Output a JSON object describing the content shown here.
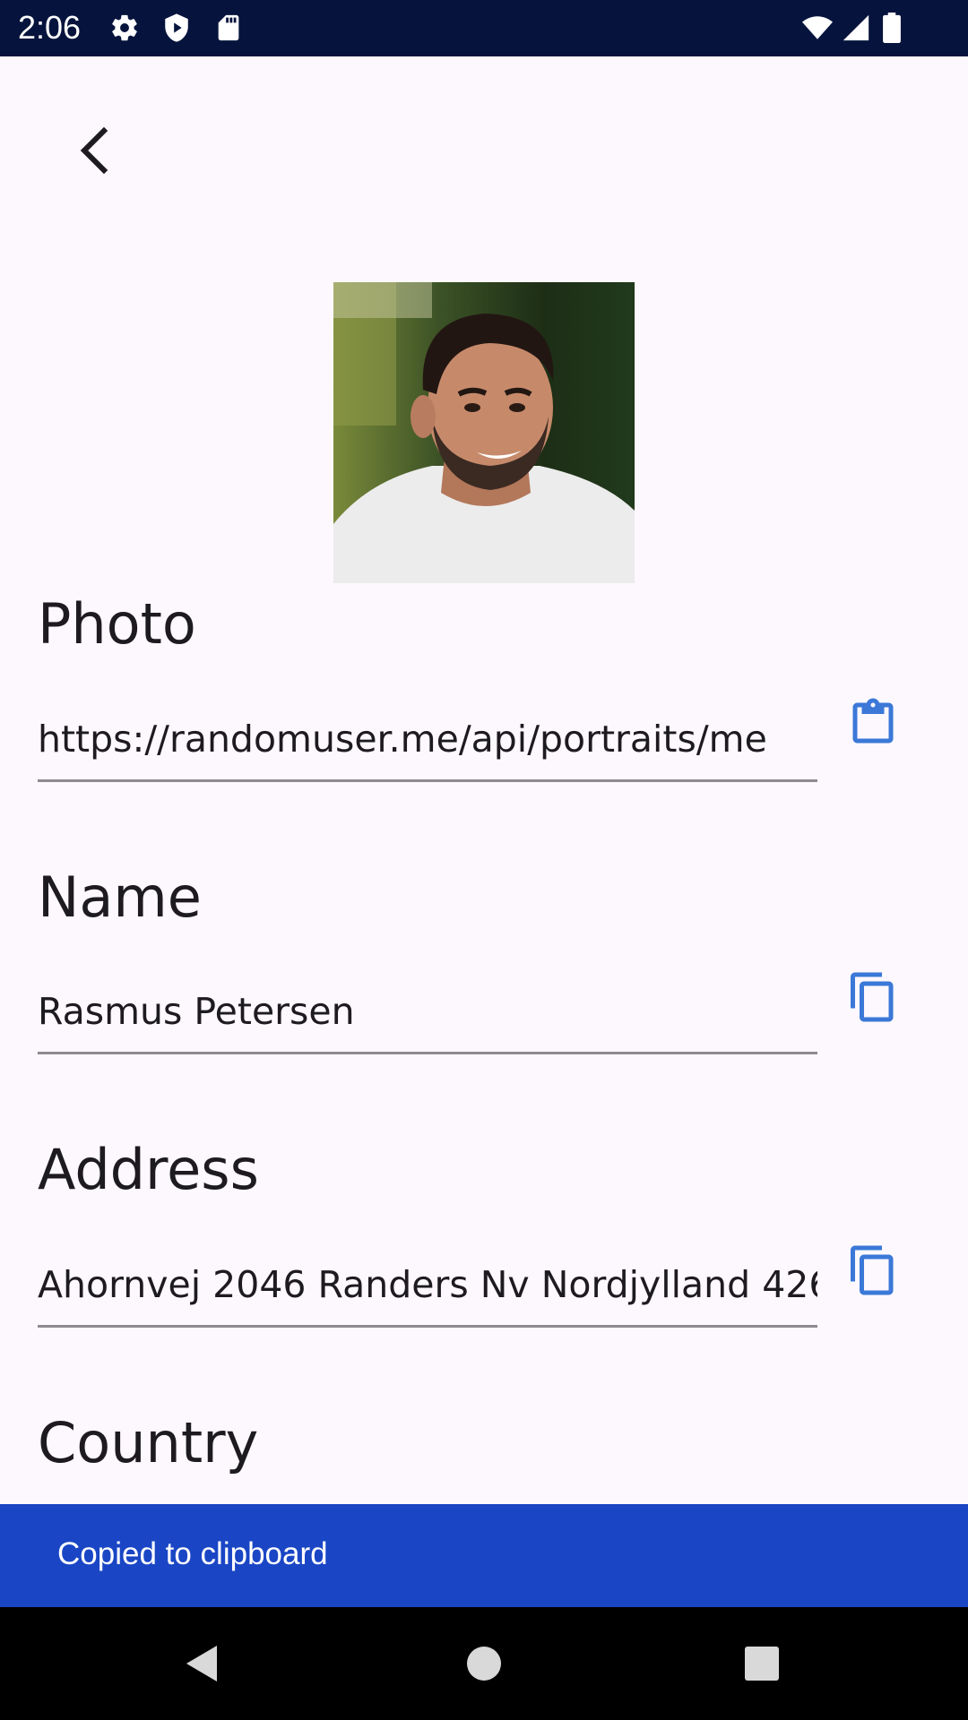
{
  "status_bar": {
    "time": "2:06",
    "icons": [
      "settings-icon",
      "shield-icon",
      "sd-card-icon",
      "wifi-icon",
      "signal-icon",
      "battery-icon"
    ]
  },
  "header": {
    "back_icon": "chevron-left-icon"
  },
  "sections": {
    "photo": {
      "title": "Photo",
      "value": "https://randomuser.me/api/portraits/me",
      "action_icon": "clipboard-icon"
    },
    "name": {
      "title": "Name",
      "value": "Rasmus Petersen",
      "action_icon": "copy-icon"
    },
    "address": {
      "title": "Address",
      "value": "Ahornvej 2046 Randers Nv Nordjylland 426",
      "action_icon": "copy-icon"
    },
    "country": {
      "title": "Country"
    }
  },
  "snackbar": {
    "message": "Copied to clipboard"
  },
  "nav_bar": {
    "icons": [
      "back-triangle-icon",
      "home-circle-icon",
      "recents-square-icon"
    ]
  },
  "colors": {
    "status_bar": "#06143d",
    "background": "#fdf8fd",
    "accent": "#3b78d8",
    "snackbar": "#1a46c5",
    "nav_bar": "#000000"
  }
}
